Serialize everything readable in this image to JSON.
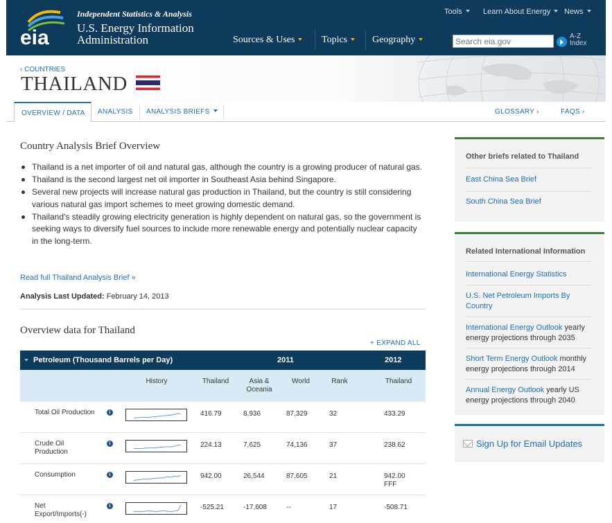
{
  "header": {
    "logo_text": "eia",
    "tagline": "Independent Statistics & Analysis",
    "agency_line1": "U.S. Energy Information",
    "agency_line2": "Administration",
    "util_nav": [
      "Tools",
      "Learn About Energy",
      "News"
    ],
    "main_nav": [
      "Sources & Uses",
      "Topics",
      "Geography"
    ],
    "search_placeholder": "Search eia.gov",
    "az_line1": "A-Z",
    "az_line2": "Index"
  },
  "banner": {
    "breadcrumb": "‹ COUNTRIES",
    "title": "THAILAND",
    "flag_colors": [
      "#d8262b",
      "#ffffff",
      "#2b2a6a",
      "#ffffff",
      "#d8262b"
    ]
  },
  "tabs": {
    "left": [
      "OVERVIEW / DATA",
      "ANALYSIS",
      "ANALYSIS BRIEFS"
    ],
    "glossary": "GLOSSARY ›",
    "faqs": "FAQS ›"
  },
  "overview": {
    "heading": "Country Analysis Brief Overview",
    "bullets": [
      "Thailand is a net importer of oil and natural gas, although the country is a growing producer of natural gas.",
      "Thailand is the second largest net oil importer in Southeast Asia behind Singapore.",
      "Several new projects will increase natural gas production in Thailand, but the country is still considering various natural gas import schemes to meet growing domestic demand.",
      "Thailand's steadily growing electricity generation is highly dependent on natural gas, so the government is seeking ways to diversify fuel sources to include more renewable energy and potentially nuclear capacity in the long-term."
    ],
    "read_full": "Read full Thailand Analysis Brief »",
    "updated_label": "Analysis Last Updated:",
    "updated_value": "February 14, 2013"
  },
  "data_table": {
    "heading": "Overview data for Thailand",
    "expand_all": "+ EXPAND ALL",
    "section_title": "Petroleum (Thousand Barrels per Day)",
    "year_2011": "2011",
    "year_2012": "2012",
    "columns": [
      "History",
      "Thailand",
      "Asia & Oceania",
      "World",
      "Rank",
      "Thailand"
    ],
    "rows": [
      {
        "label": "Total Oil Production",
        "thailand": "416.79",
        "asia": "8,936",
        "world": "87,329",
        "rank": "32",
        "thailand_2012": "433.29",
        "note": ""
      },
      {
        "label": "Crude Oil Production",
        "thailand": "224.13",
        "asia": "7,625",
        "world": "74,136",
        "rank": "37",
        "thailand_2012": "238.62",
        "note": ""
      },
      {
        "label": "Consumption",
        "thailand": "942.00",
        "asia": "26,544",
        "world": "87,605",
        "rank": "21",
        "thailand_2012": "942.00",
        "note": "FFF"
      },
      {
        "label": "Net Export/Imports(-)",
        "thailand": "-525.21",
        "asia": "-17,608",
        "world": "--",
        "rank": "17",
        "thailand_2012": "-508.71",
        "note": ""
      }
    ]
  },
  "sidebar": {
    "briefs_title": "Other briefs related to Thailand",
    "briefs": [
      "East China Sea Brief",
      "South China Sea Brief"
    ],
    "intl_title": "Related International Information",
    "intl_links": [
      {
        "link": "International Energy Statistics",
        "desc": ""
      },
      {
        "link": "U.S. Net Petroleum Imports By Country",
        "desc": ""
      },
      {
        "link": "International Energy Outlook",
        "desc": " yearly energy projections through 2035"
      },
      {
        "link": "Short Term Energy Outlook",
        "desc": " monthly energy projections through 2014"
      },
      {
        "link": "Annual Energy Outlook",
        "desc": " yearly US energy projections through 2040"
      }
    ],
    "email": "Sign Up for Email Updates"
  },
  "colors": {
    "header_bg": "#0e3a5b",
    "link": "#1f6fb5",
    "table_subhead_bg": "#d8eaf6",
    "sidebar_accent": "#3a7f3a",
    "nav_caret": "#f5b800"
  }
}
